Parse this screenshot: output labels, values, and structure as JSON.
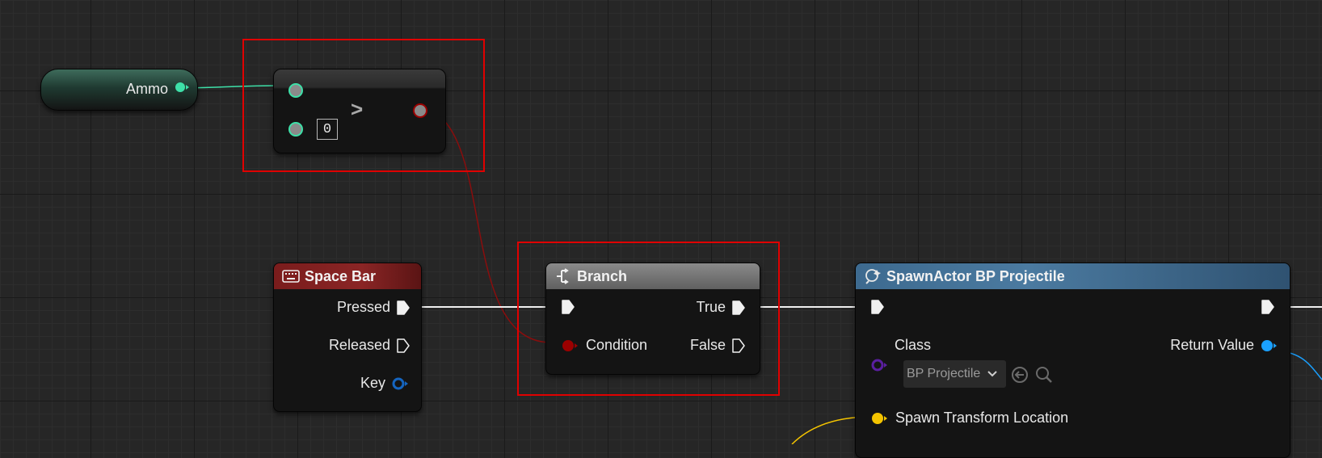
{
  "ammo_node": {
    "label": "Ammo"
  },
  "compare_node": {
    "operator": ">",
    "default_value": "0"
  },
  "spacebar_node": {
    "title": "Space Bar",
    "pins": {
      "pressed": "Pressed",
      "released": "Released",
      "key": "Key"
    }
  },
  "branch_node": {
    "title": "Branch",
    "pins": {
      "condition": "Condition",
      "true": "True",
      "false": "False"
    }
  },
  "spawn_node": {
    "title": "SpawnActor BP Projectile",
    "pins": {
      "class": "Class",
      "class_value": "BP Projectile",
      "return_value": "Return Value",
      "spawn_transform": "Spawn Transform Location"
    }
  },
  "colors": {
    "grid_bg": "#262626",
    "exec_wire": "#ffffff",
    "float_pin": "#3ee0a8",
    "bool_pin": "#9b0000",
    "struct_key_pin": "#1565c0",
    "object_pin": "#1aa0ff",
    "class_pin": "#5a1fa0",
    "transform_pin": "#f4c400",
    "highlight": "#e00000"
  },
  "icons": [
    "keyboard-icon",
    "branch-icon",
    "spawn-actor-icon",
    "chevron-down-icon",
    "use-selected-icon",
    "browse-icon"
  ]
}
